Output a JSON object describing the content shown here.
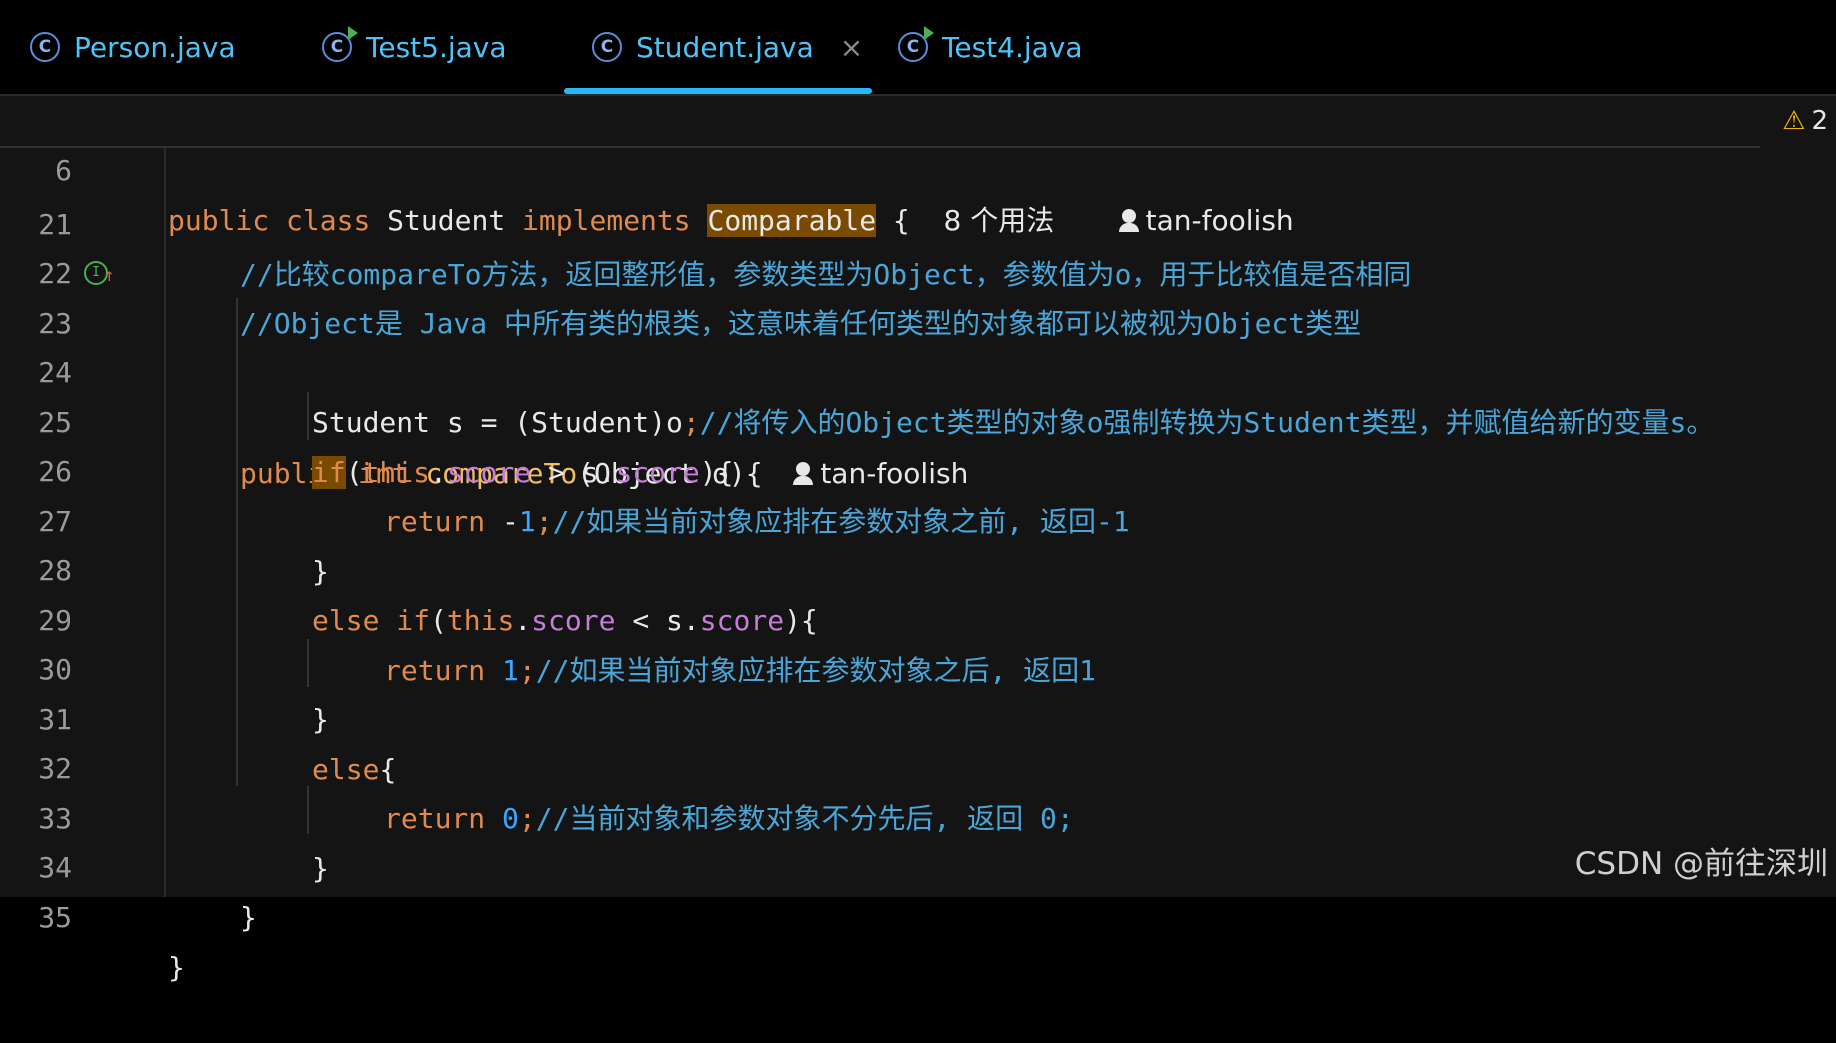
{
  "tabs": [
    {
      "label": "Person.java",
      "icon": "class-icon"
    },
    {
      "label": "Test5.java",
      "icon": "runnable-class-icon"
    },
    {
      "label": "Student.java",
      "icon": "class-icon",
      "active": true,
      "close": "×"
    },
    {
      "label": "Test4.java",
      "icon": "runnable-class-icon"
    }
  ],
  "sticky": {
    "line": "6",
    "kw1": "public",
    "kw2": "class",
    "name": "Student",
    "kw3": "implements",
    "iface": "Comparable",
    "brace": "{",
    "usages": "8 个用法",
    "author": "tan-foolish",
    "warnings": "2"
  },
  "lines": [
    {
      "n": "21",
      "comment": "//比较compareTo方法，返回整形值，参数类型为Object，参数值为o，用于比较值是否相同"
    },
    {
      "n": "22",
      "comment": "//Object是 Java 中所有类的根类，这意味着任何类型的对象都可以被视为Object类型"
    },
    {
      "n": "23",
      "kw": "public",
      "type": "int",
      "fn": "compareTo",
      "rest": "(Object o){",
      "author": "tan-foolish"
    },
    {
      "n": "24",
      "code": "Student s = (Student)o",
      "semi": ";",
      "comment": "//将传入的Object类型的对象o强制转换为Student类型，并赋值给新的变量s。"
    },
    {
      "n": "25",
      "kw": "if",
      "p1": "(",
      "this": "this",
      "dot1": ".",
      "f1": "score",
      "op": " > s.",
      "f2": "score",
      "p2": "){"
    },
    {
      "n": "26",
      "kw": "return",
      "minus": " -",
      "num": "1",
      "semi": ";",
      "comment": "//如果当前对象应排在参数对象之前, 返回-1"
    },
    {
      "n": "27",
      "code": "}"
    },
    {
      "n": "28",
      "kw": "else if",
      "p1": "(",
      "this": "this",
      "dot1": ".",
      "f1": "score",
      "op": " < s.",
      "f2": "score",
      "p2": "){"
    },
    {
      "n": "29",
      "kw": "return",
      "num": " 1",
      "semi": ";",
      "comment": "//如果当前对象应排在参数对象之后, 返回1"
    },
    {
      "n": "30",
      "code": "}"
    },
    {
      "n": "31",
      "kw": "else",
      "code": "{"
    },
    {
      "n": "32",
      "kw": "return",
      "num": " 0",
      "semi": ";",
      "comment": "//当前对象和参数对象不分先后, 返回 0;"
    },
    {
      "n": "33",
      "code": "}"
    },
    {
      "n": "34",
      "code": "}"
    },
    {
      "n": "35",
      "code": "}"
    }
  ],
  "watermark": "CSDN @前往深圳"
}
